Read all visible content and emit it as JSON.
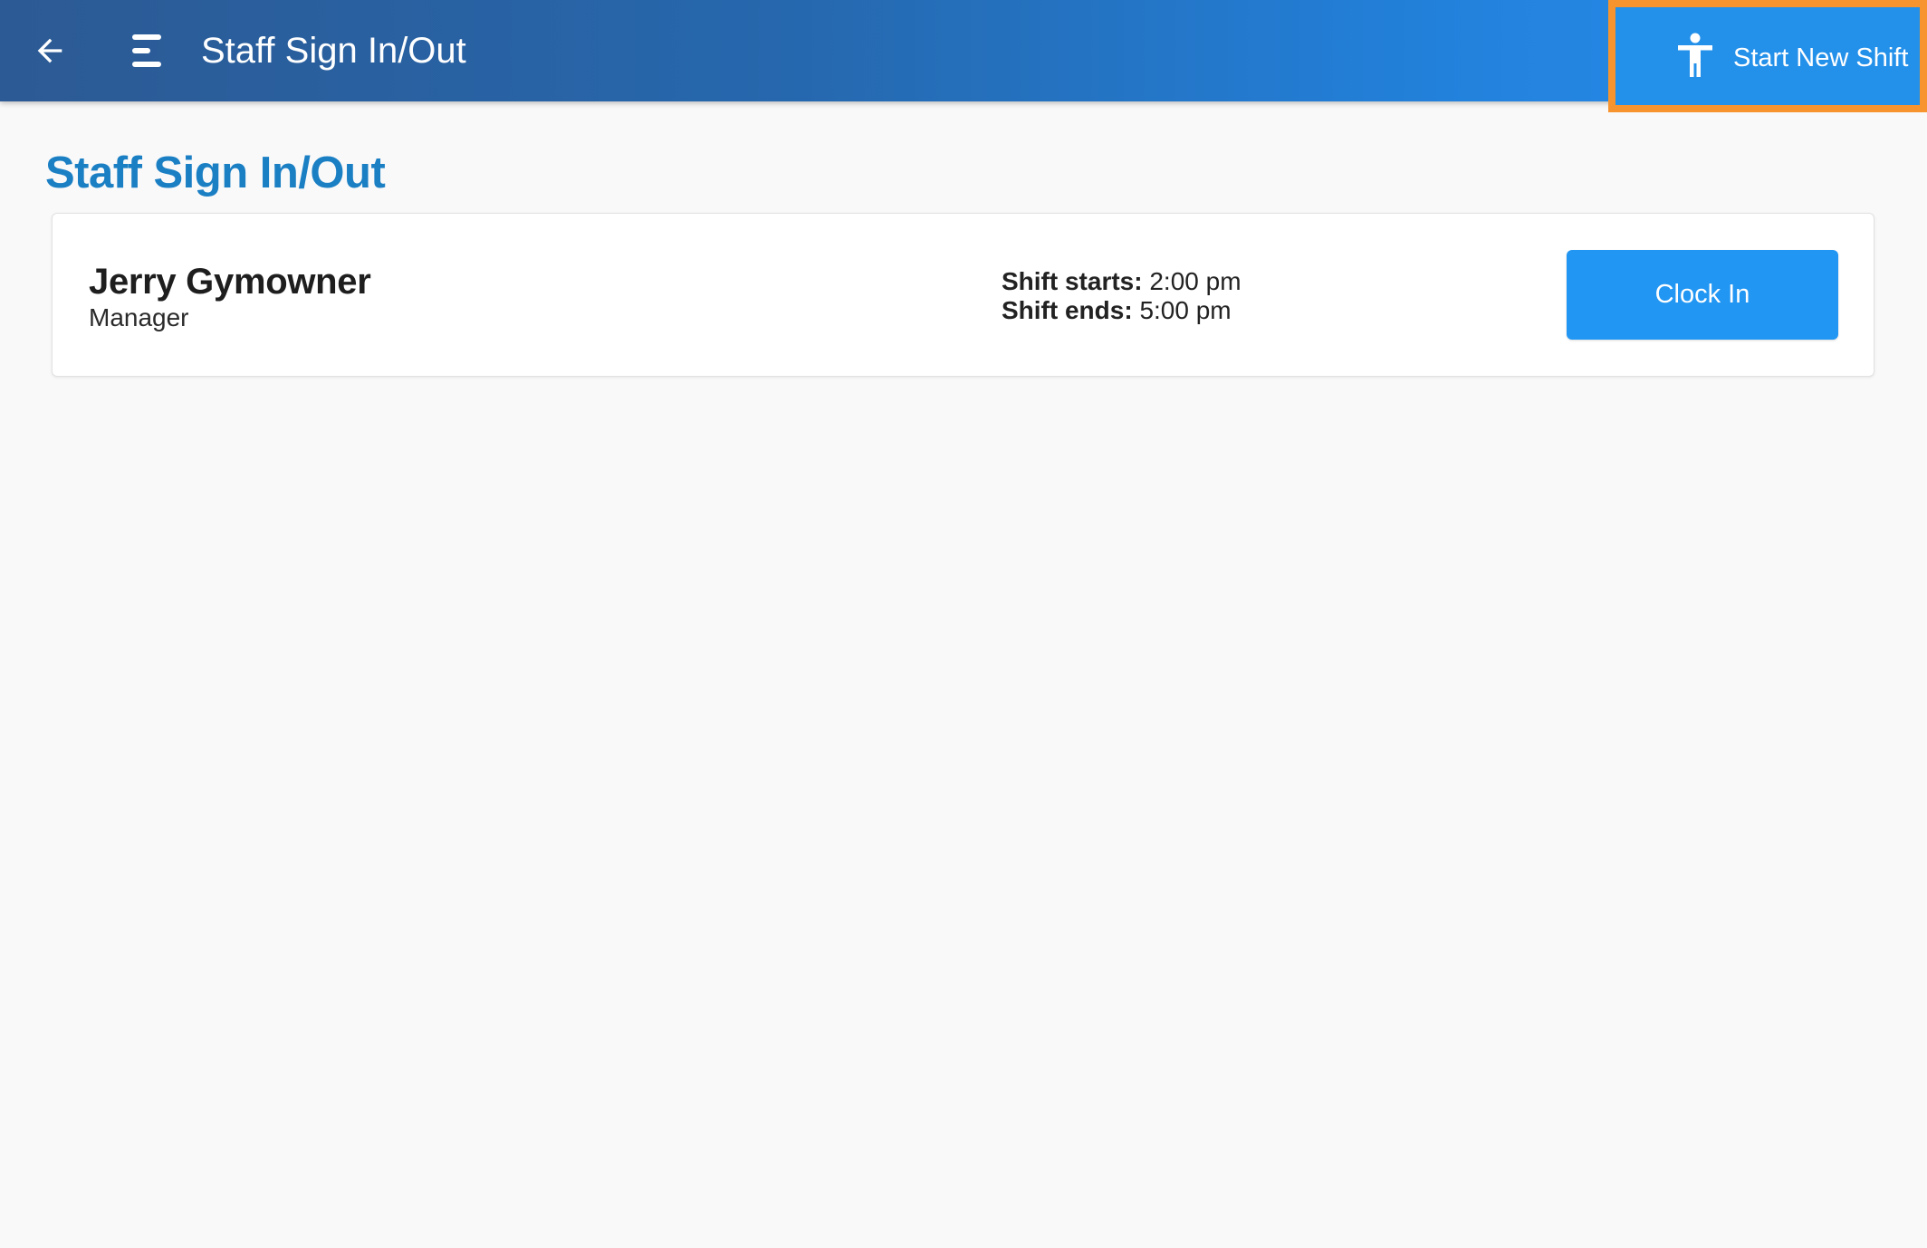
{
  "app_bar": {
    "title": "Staff Sign In/Out",
    "back_icon": "arrow-left-icon",
    "menu_icon": "menu-icon",
    "action_button": {
      "label": "Start New Shift",
      "icon": "person-standing-icon",
      "highlight_color": "#f7942e"
    }
  },
  "page": {
    "heading": "Staff Sign In/Out",
    "heading_color": "#1b7fc4"
  },
  "staff": [
    {
      "name": "Jerry Gymowner",
      "role": "Manager",
      "shift_starts_label": "Shift starts:",
      "shift_starts_value": "2:00 pm",
      "shift_ends_label": "Shift ends:",
      "shift_ends_value": "5:00 pm",
      "action_label": "Clock In",
      "action_color": "#2196f3"
    }
  ]
}
